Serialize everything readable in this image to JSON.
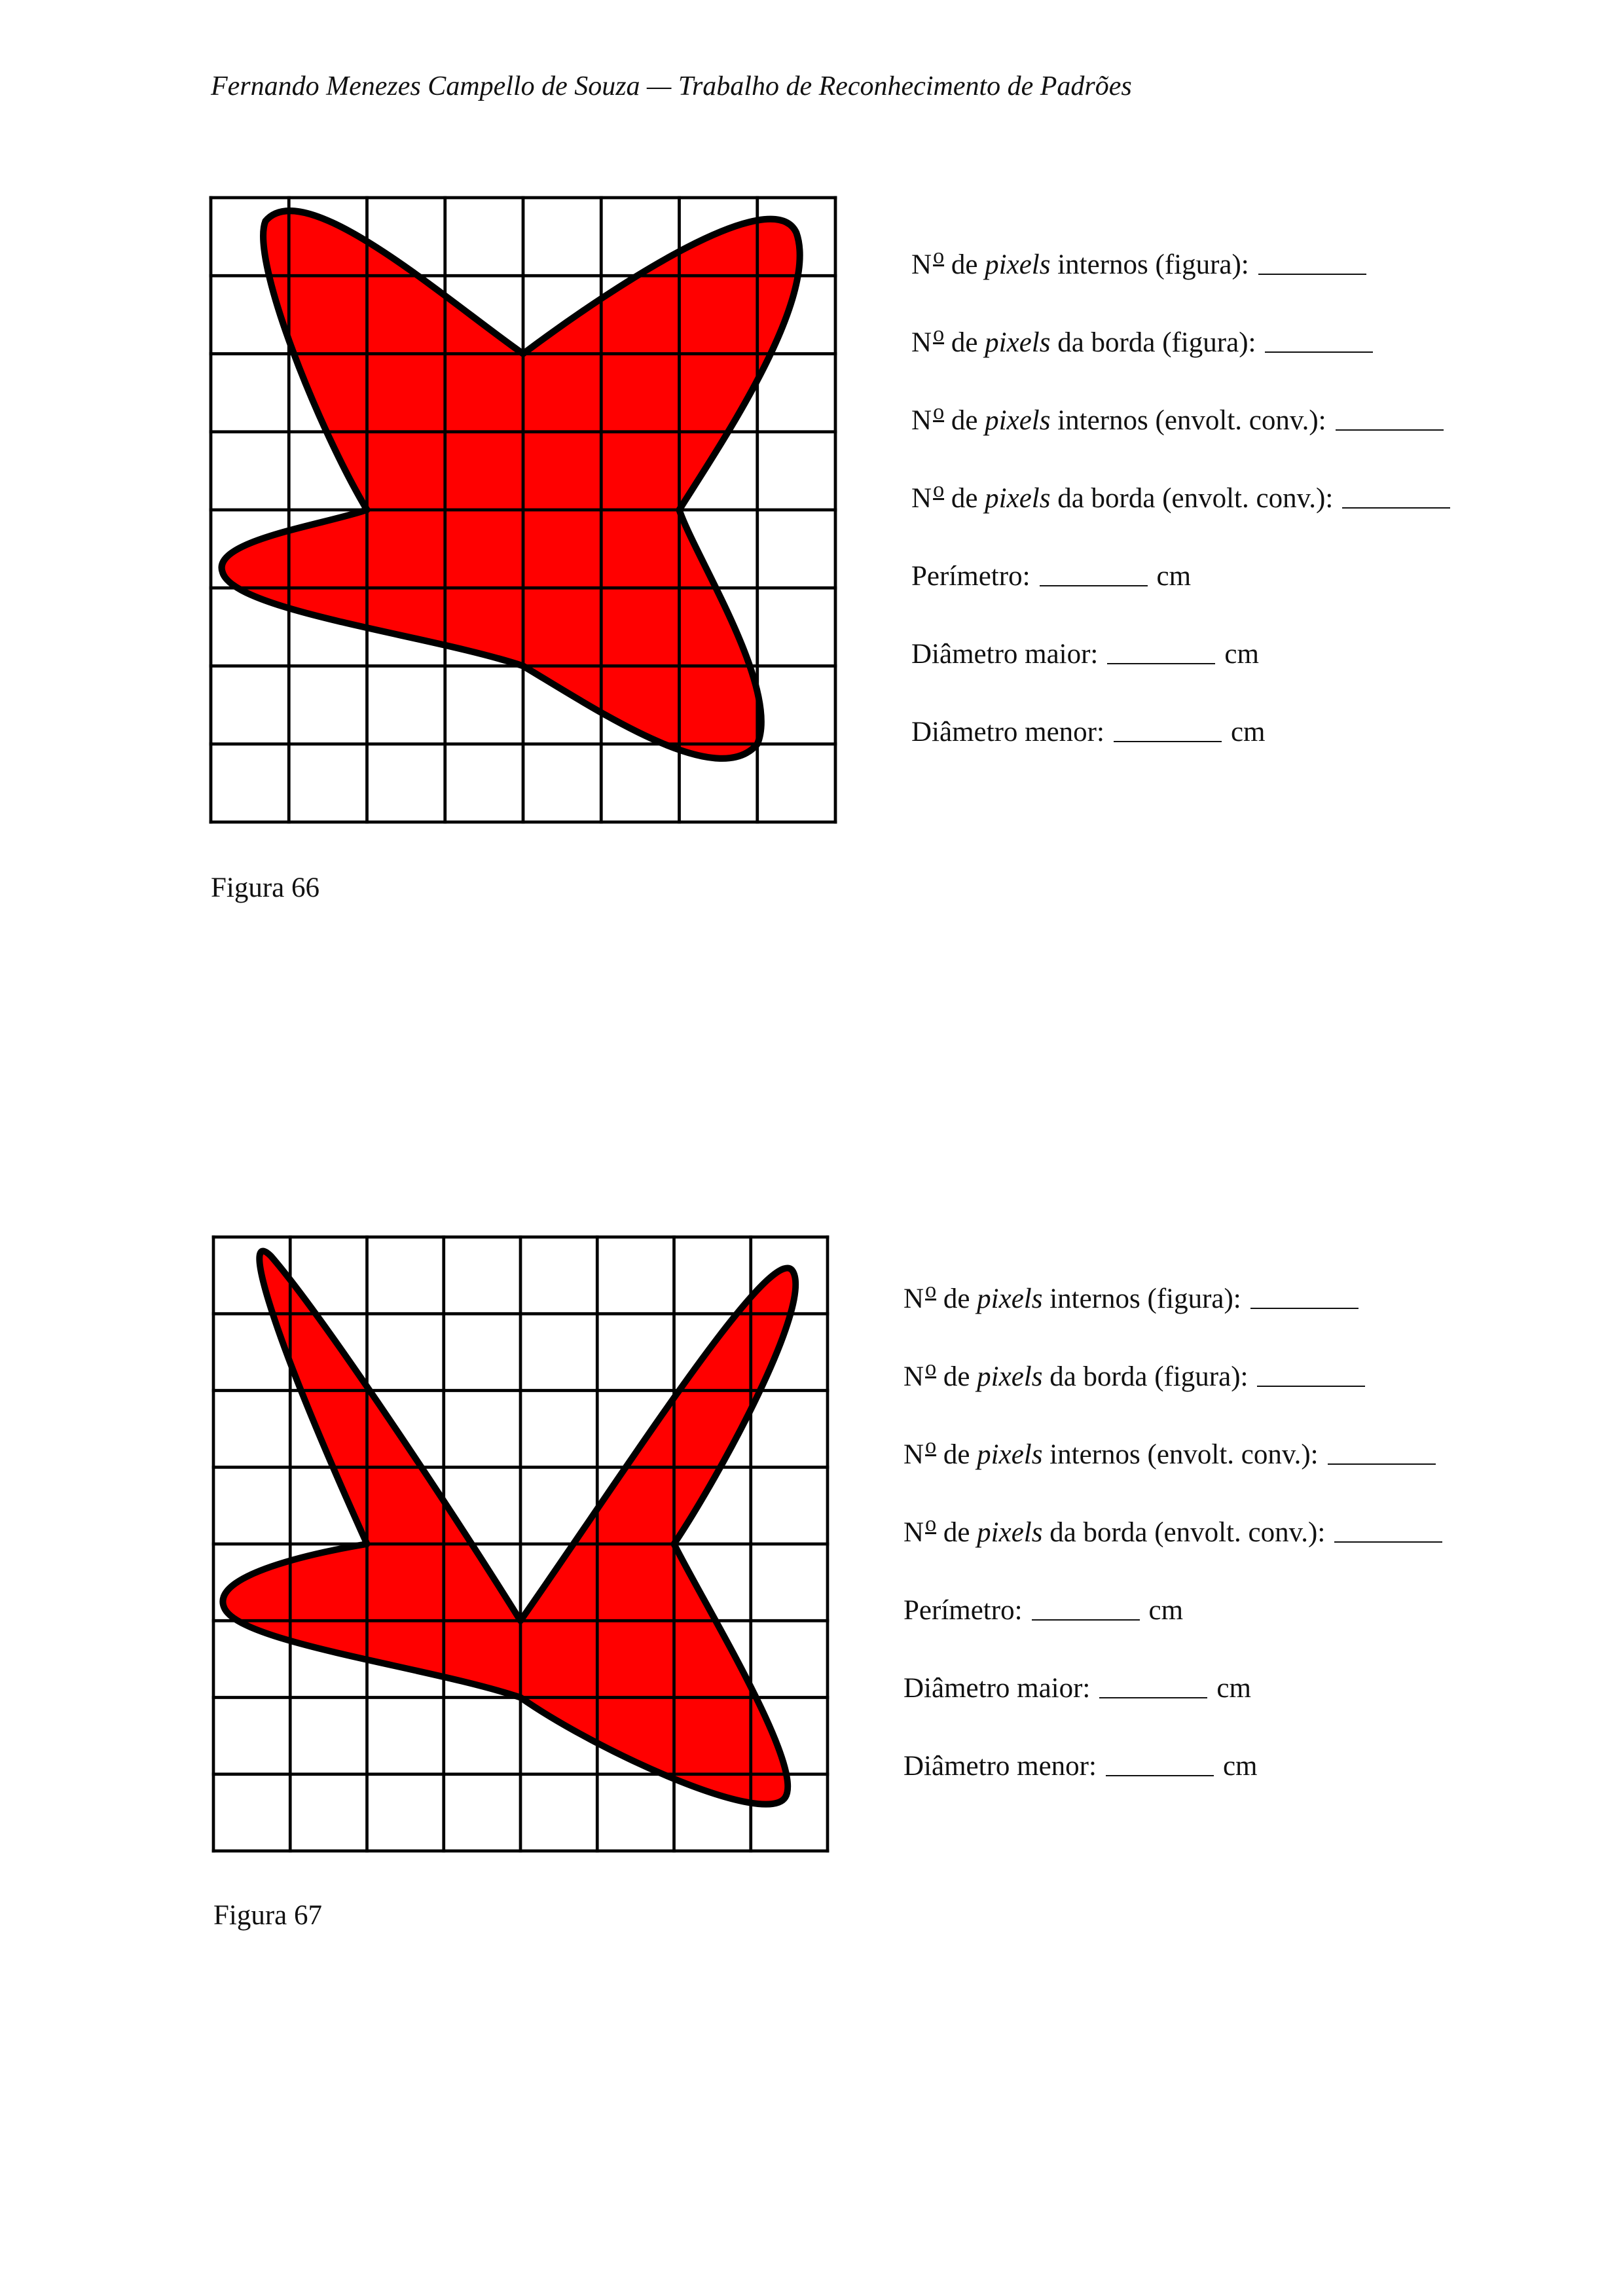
{
  "header": "Fernando Menezes Campello de Souza — Trabalho de Reconhecimento de Padrões",
  "colors": {
    "shape_fill": "#ff0000",
    "shape_stroke": "#000000",
    "grid": "#000000"
  },
  "grid": {
    "rows": 8,
    "cols": 8
  },
  "labels": {
    "num_prefix": "N",
    "num_sup": "o",
    "de": "de",
    "pixels": "pixels",
    "internal_figure": "internos (figura):",
    "border_figure": "da borda (figura):",
    "internal_hull": "internos (envolt. conv.):",
    "border_hull": "da borda (envolt. conv.):",
    "perimeter": "Perímetro:",
    "major_diameter": "Diâmetro maior:",
    "minor_diameter": "Diâmetro menor:",
    "unit_cm": "cm"
  },
  "figures": [
    {
      "caption": "Figura 66"
    },
    {
      "caption": "Figura 67"
    }
  ]
}
